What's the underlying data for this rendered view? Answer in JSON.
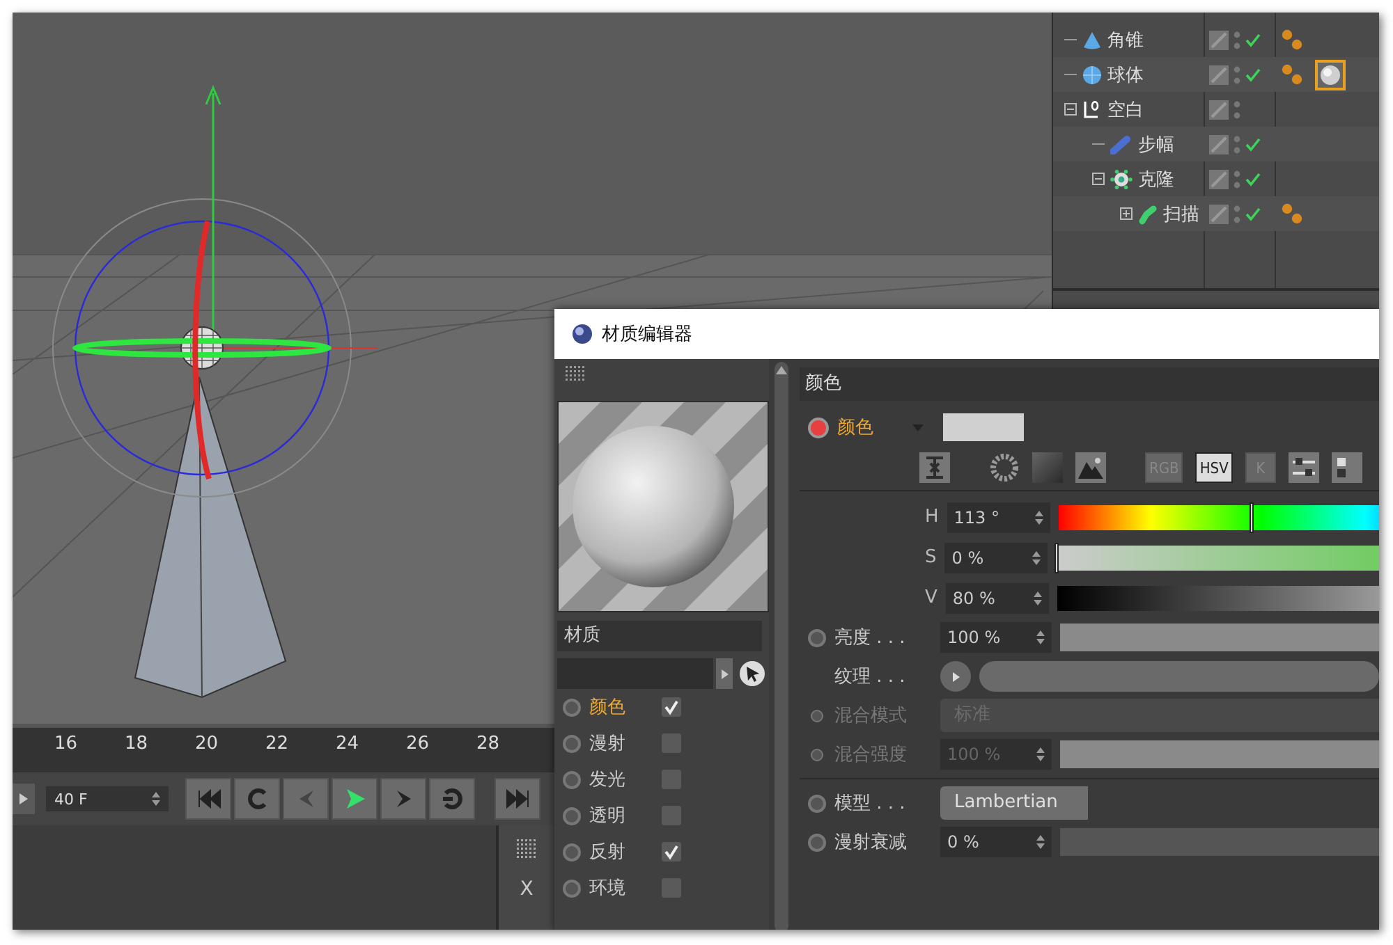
{
  "object_manager": {
    "objects": [
      {
        "name": "角锥",
        "kind": "cone",
        "enabled": true,
        "tags": [
          {
            "kind": "phong"
          }
        ]
      },
      {
        "name": "球体",
        "kind": "sphere",
        "enabled": true,
        "tags": [
          {
            "kind": "phong"
          },
          {
            "kind": "material",
            "selected": true
          }
        ]
      },
      {
        "name": "空白",
        "kind": "null",
        "enabled": false,
        "expanded": true,
        "children": [
          {
            "name": "步幅",
            "kind": "effector",
            "enabled": true
          },
          {
            "name": "克隆",
            "kind": "cloner",
            "enabled": true,
            "expanded": true,
            "children": [
              {
                "name": "扫描",
                "kind": "sweep",
                "enabled": true,
                "expanded": false,
                "tags": [
                  {
                    "kind": "phong"
                  }
                ]
              }
            ]
          }
        ]
      }
    ]
  },
  "timeline": {
    "ticks": [
      "16",
      "18",
      "20",
      "22",
      "24",
      "26",
      "28"
    ],
    "frame_field": "40 F"
  },
  "coordinates": {
    "axis_label": "X"
  },
  "material_editor": {
    "title": "材质编辑器",
    "name": "材质",
    "channels": [
      {
        "label": "颜色",
        "checked": true,
        "selected": true
      },
      {
        "label": "漫射",
        "checked": false,
        "selected": false
      },
      {
        "label": "发光",
        "checked": false,
        "selected": false
      },
      {
        "label": "透明",
        "checked": false,
        "selected": false
      },
      {
        "label": "反射",
        "checked": true,
        "selected": false
      },
      {
        "label": "环境",
        "checked": false,
        "selected": false
      }
    ],
    "section_title": "颜色",
    "color_label": "颜色",
    "color_animated": true,
    "modes": [
      {
        "label": "RGB",
        "selected": false
      },
      {
        "label": "HSV",
        "selected": true
      },
      {
        "label": "K",
        "selected": false
      }
    ],
    "hsv": [
      {
        "kind": "hue",
        "label": "H",
        "value": "113 °",
        "level": 0.314
      },
      {
        "kind": "saturation",
        "label": "S",
        "value": "0 %",
        "level": 0
      },
      {
        "kind": "value",
        "label": "V",
        "value": "80 %"
      }
    ],
    "params": [
      {
        "kind": "slider",
        "label": "亮度 . . .",
        "value": "100 %",
        "level": 1,
        "disabled": false
      },
      {
        "kind": "texture",
        "label": "纹理 . . .",
        "disabled": false
      },
      {
        "kind": "dropdown",
        "label": "混合模式",
        "value": "标准",
        "disabled": true
      },
      {
        "kind": "slider",
        "label": "混合强度",
        "value": "100 %",
        "level": 1,
        "disabled": true
      }
    ],
    "model_params": [
      {
        "kind": "dropdown",
        "label": "模型 . . .",
        "value": "Lambertian",
        "disabled": false
      },
      {
        "kind": "slider",
        "label": "漫射衰减",
        "value": "0 %",
        "level": 0,
        "disabled": false
      }
    ]
  }
}
